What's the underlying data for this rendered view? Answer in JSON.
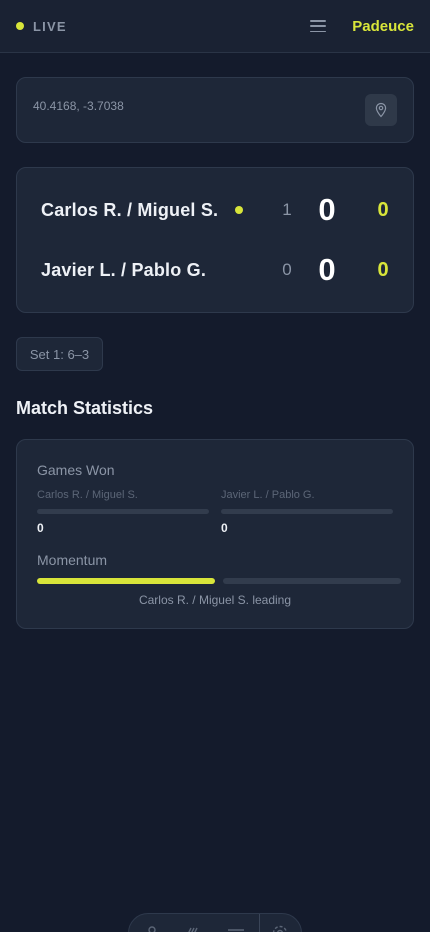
{
  "header": {
    "live_label": "LIVE",
    "brand": "Padeuce",
    "icons": [
      "live-dot",
      "menu-icon"
    ]
  },
  "location": {
    "coordinates": "40.4168, -3.7038",
    "icon": "map-pin-icon"
  },
  "scoreboard": {
    "teams": [
      {
        "name": "Carlos R. / Miguel S.",
        "sets": "1",
        "games": "0",
        "points": "0",
        "serving": true
      },
      {
        "name": "Javier L. / Pablo G.",
        "sets": "0",
        "games": "0",
        "points": "0",
        "serving": false
      }
    ]
  },
  "set_history": [
    "Set 1: 6–3"
  ],
  "statistics": {
    "title": "Match Statistics",
    "games_won": {
      "label": "Games Won",
      "team1": {
        "name": "Carlos R. / Miguel S.",
        "value": "0",
        "fraction": 0
      },
      "team2": {
        "name": "Javier L. / Pablo G.",
        "value": "0",
        "fraction": 0
      }
    },
    "momentum": {
      "label": "Momentum",
      "team1_fraction": 0.5,
      "caption": "Carlos R. / Miguel S. leading"
    }
  },
  "bottom_nav": {
    "icons": [
      "user-icon",
      "ball-icon",
      "menu-icon",
      "settings-icon"
    ]
  },
  "colors": {
    "accent": "#d8e53a",
    "background": "#141b2c",
    "card": "#1e2738"
  }
}
